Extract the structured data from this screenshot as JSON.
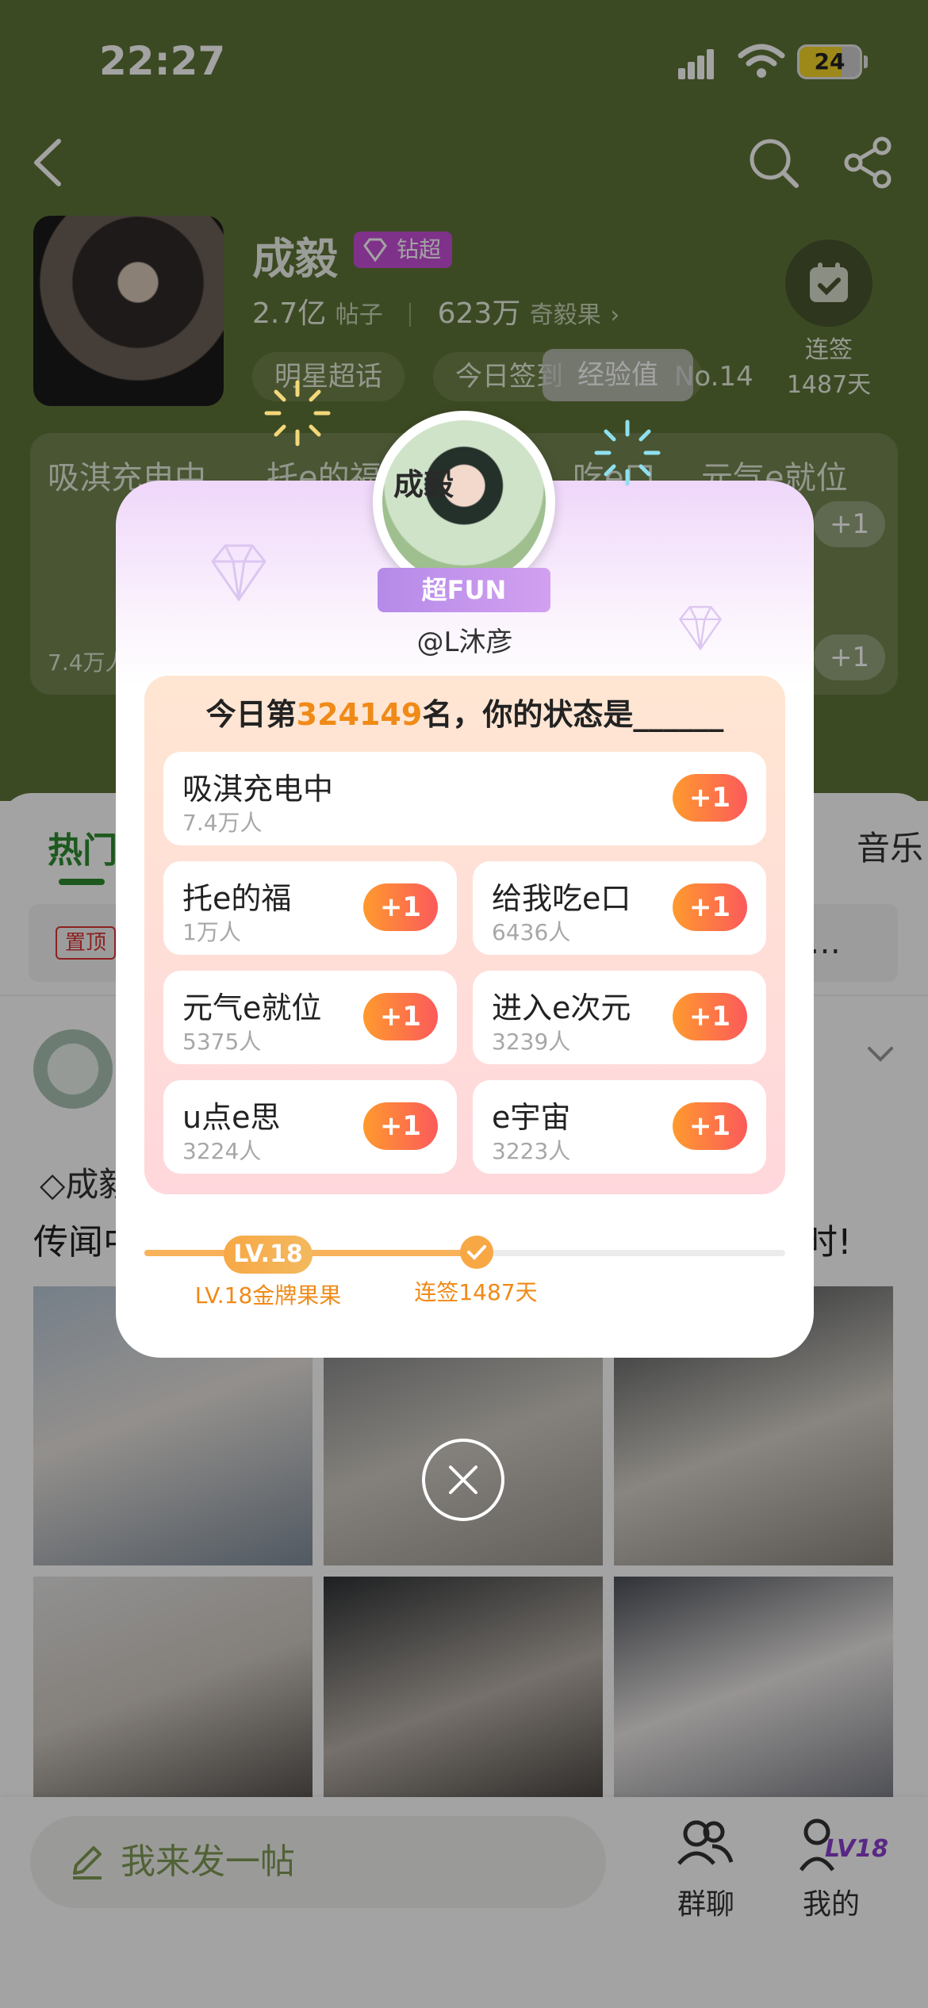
{
  "status_bar": {
    "time": "22:27",
    "battery": "24"
  },
  "header": {
    "star_name": "成毅",
    "badge": "钻超",
    "posts_count": "2.7亿",
    "posts_label": "帖子",
    "fans_count": "623万",
    "fans_label": "奇毅果",
    "chips": [
      "明星超话",
      "今日签到",
      "No.14"
    ],
    "checkin_label": "连签",
    "checkin_days": "1487天",
    "exp_tooltip": "经验值"
  },
  "background_options": {
    "row1": [
      "吸淇充电中",
      "托e的福",
      "吃e口",
      "元气e就位"
    ],
    "count_left": "7.4万人",
    "plus": "+1"
  },
  "tabs": {
    "hot": "热门",
    "music": "音乐"
  },
  "feed": {
    "pinned_tag": "置顶",
    "pinned_tail": "…",
    "post_user": "成毅",
    "post_line": "传闻中",
    "post_tail": "时!"
  },
  "modal": {
    "fun_label": "超FUN",
    "avatar_text": "成毅",
    "handle": "@L沐彦",
    "title_prefix": "今日第",
    "rank": "324149",
    "title_suffix": "名，你的状态是______",
    "options": [
      {
        "name": "吸淇充电中",
        "count": "7.4万人",
        "plus": "+1"
      },
      {
        "name": "托e的福",
        "count": "1万人",
        "plus": "+1"
      },
      {
        "name": "给我吃e口",
        "count": "6436人",
        "plus": "+1"
      },
      {
        "name": "元气e就位",
        "count": "5375人",
        "plus": "+1"
      },
      {
        "name": "进入e次元",
        "count": "3239人",
        "plus": "+1"
      },
      {
        "name": "u点e思",
        "count": "3224人",
        "plus": "+1"
      },
      {
        "name": "e宇宙",
        "count": "3223人",
        "plus": "+1"
      }
    ],
    "level_pill": "LV.18",
    "level_label": "LV.18金牌果果",
    "streak_label": "连签1487天"
  },
  "bottom_bar": {
    "compose_placeholder": "我来发一帖",
    "group_label": "群聊",
    "mine_label": "我的",
    "mine_level": "LV18"
  },
  "colors": {
    "header_green": "#5e7437",
    "accent_green": "#2e8b30",
    "accent_orange": "#f08a17",
    "plus_gradient_start": "#ff9a2e",
    "plus_gradient_end": "#fb5a5a",
    "badge_purple": "#c74fd8"
  },
  "icons": [
    "back-icon",
    "search-icon",
    "share-icon",
    "calendar-check-icon",
    "diamond-icon",
    "close-icon",
    "pencil-icon",
    "group-chat-icon",
    "profile-icon",
    "chevron-down-icon"
  ]
}
